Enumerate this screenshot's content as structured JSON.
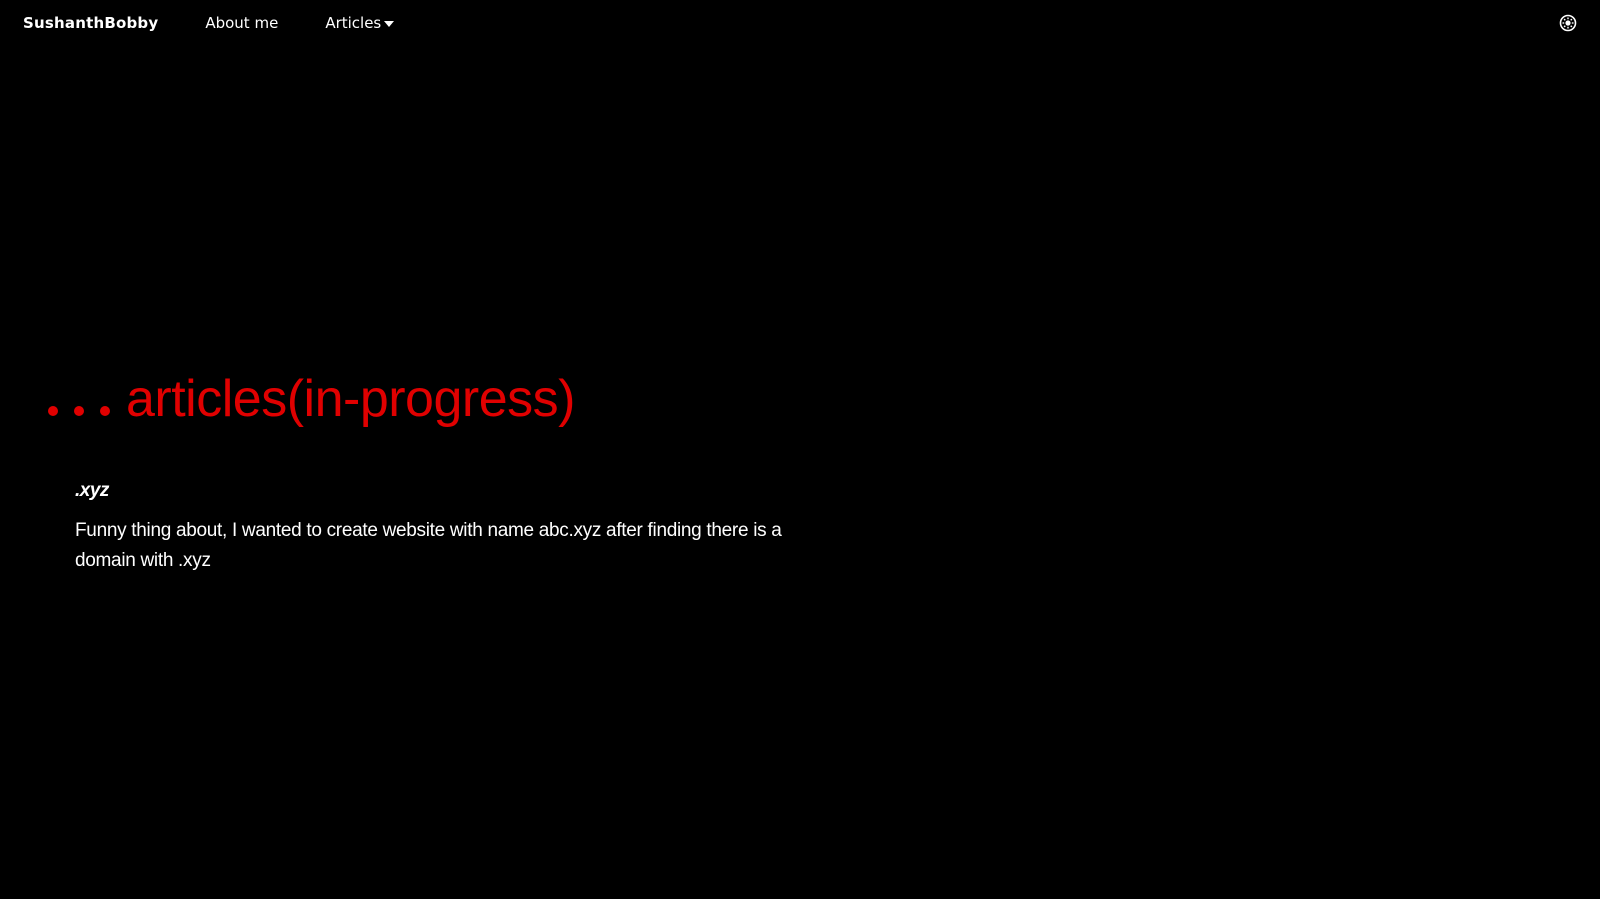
{
  "nav": {
    "brand": "SushanthBobby",
    "links": [
      {
        "label": "About me"
      },
      {
        "label": "Articles"
      }
    ],
    "theme_toggle_icon": "theme-toggle-icon"
  },
  "hero": {
    "title": "articles(in-progress)",
    "accent_color": "#e00000"
  },
  "articles": [
    {
      "title": ".xyz",
      "description": "Funny thing about, I wanted to create website with name abc.xyz after finding there is a domain with .xyz"
    }
  ]
}
